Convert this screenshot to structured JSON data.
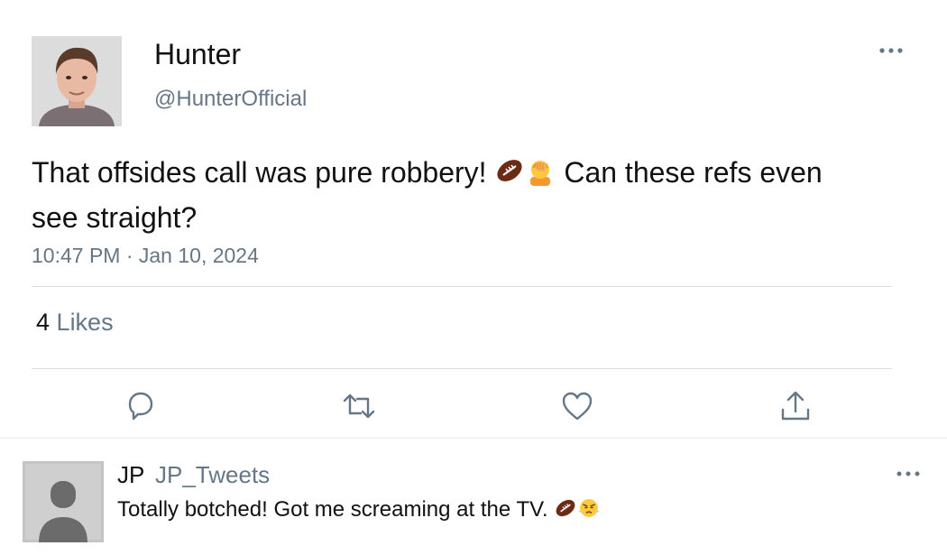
{
  "tweet": {
    "author_name": "Hunter",
    "author_handle": "@HunterOfficial",
    "text_part1": "That offsides call was pure robbery!",
    "text_part2": "Can these refs even see straight?",
    "emojis": [
      "football-icon",
      "facepalm-icon"
    ],
    "timestamp": "10:47 PM · Jan 10, 2024",
    "likes_count": "4",
    "likes_label": "Likes",
    "actions": [
      "reply-icon",
      "retweet-icon",
      "like-icon",
      "share-icon"
    ]
  },
  "reply": {
    "author_name": "JP",
    "author_handle": "JP_Tweets",
    "text": "Totally botched! Got me screaming at the TV.",
    "emojis": [
      "football-icon",
      "angry-face-icon"
    ]
  },
  "colors": {
    "text": "#111111",
    "muted": "#657786",
    "divider": "#d8dee3",
    "icon": "#657786"
  }
}
